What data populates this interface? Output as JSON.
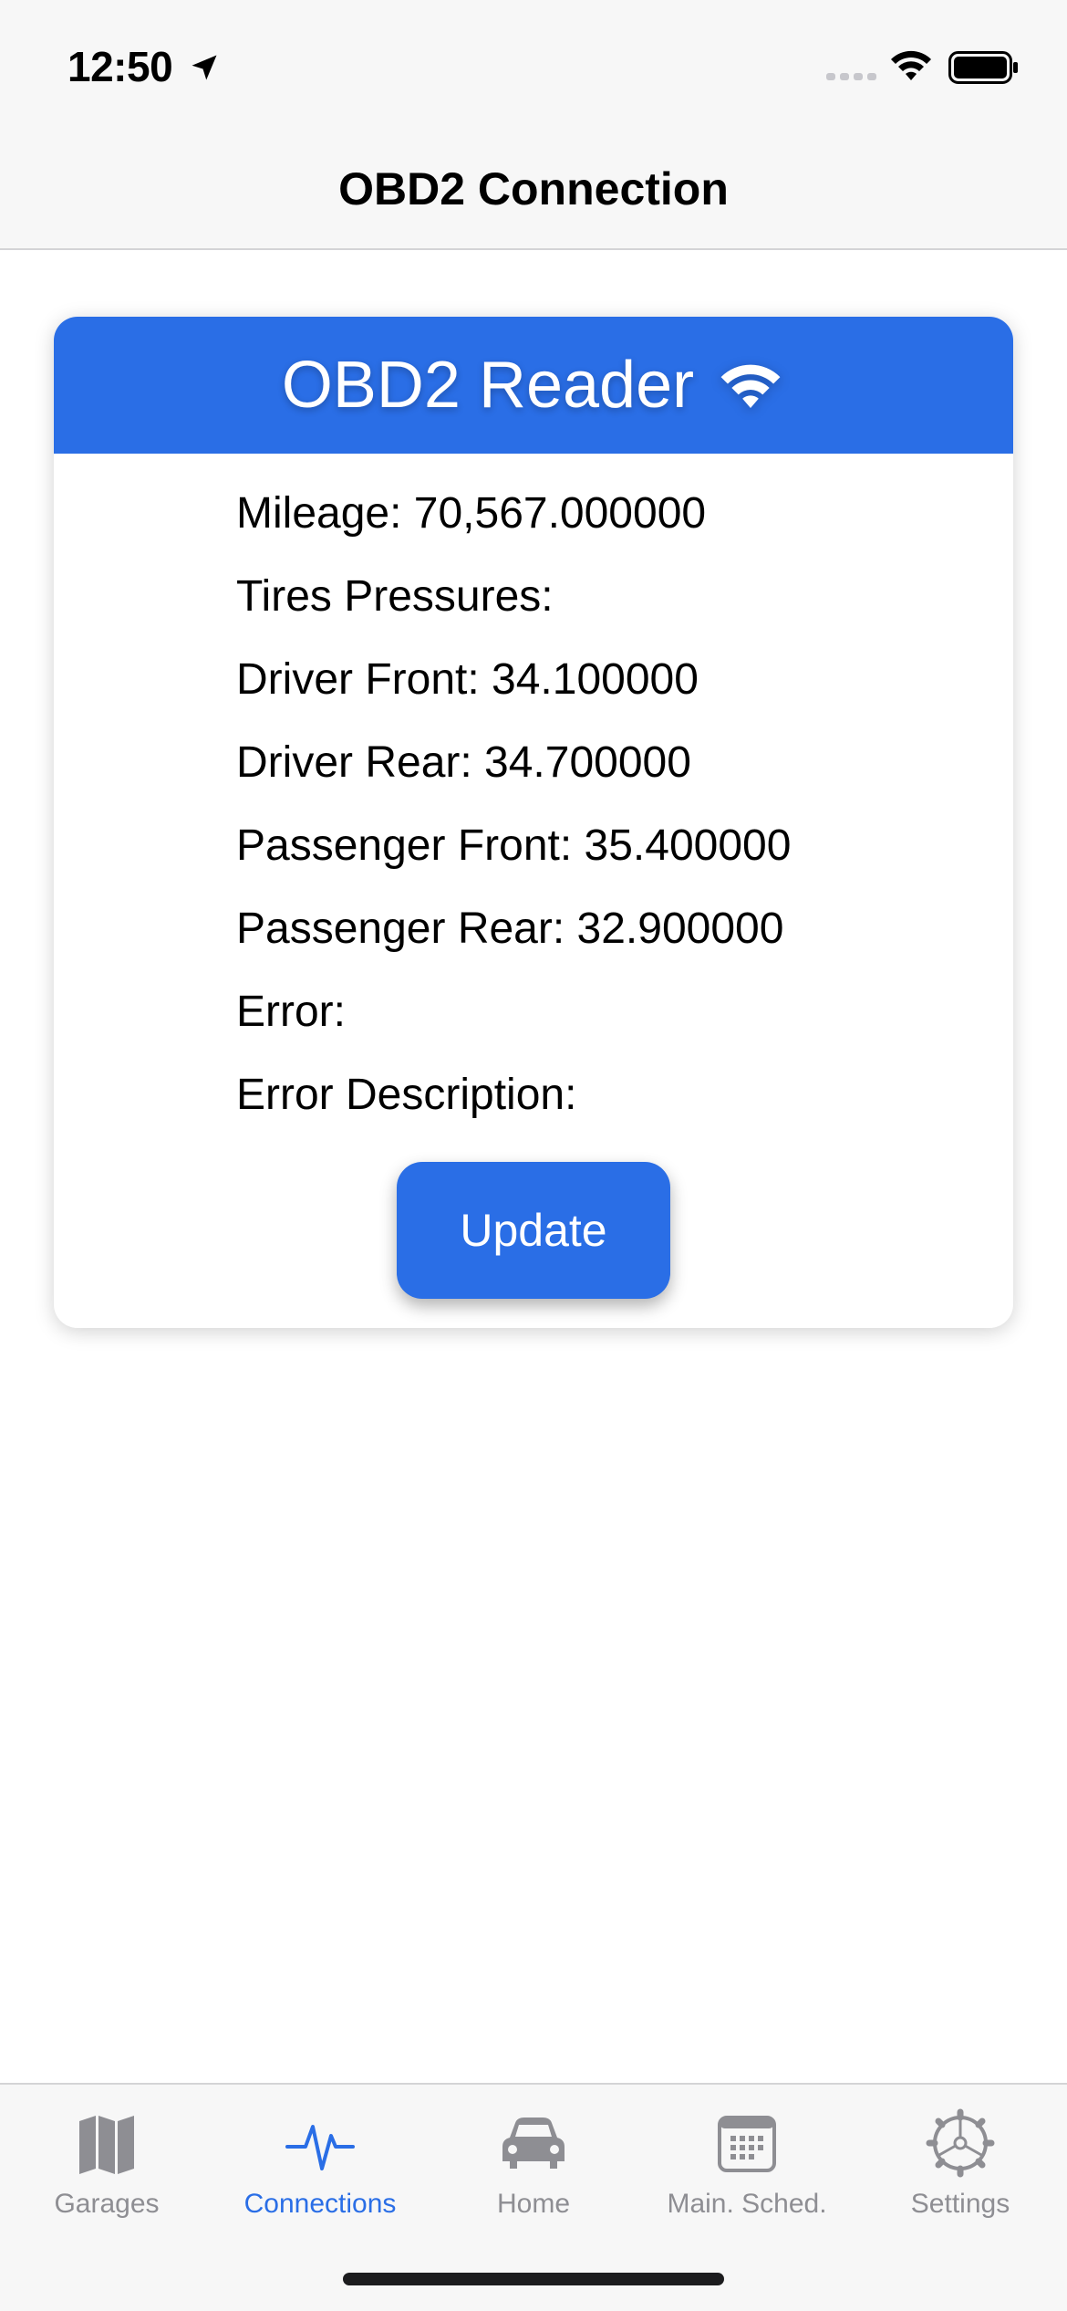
{
  "status_bar": {
    "time": "12:50"
  },
  "nav": {
    "title": "OBD2 Connection"
  },
  "card": {
    "title": "OBD2 Reader",
    "readings": [
      "Mileage: 70,567.000000",
      "Tires Pressures:",
      "Driver Front: 34.100000",
      "Driver Rear: 34.700000",
      "Passenger Front: 35.400000",
      "Passenger Rear: 32.900000",
      "Error:",
      "Error Description:"
    ],
    "update_label": "Update"
  },
  "tabs": [
    {
      "label": "Garages",
      "icon": "map-icon",
      "active": false
    },
    {
      "label": "Connections",
      "icon": "pulse-icon",
      "active": true
    },
    {
      "label": "Home",
      "icon": "car-icon",
      "active": false
    },
    {
      "label": "Main. Sched.",
      "icon": "calendar-icon",
      "active": false
    },
    {
      "label": "Settings",
      "icon": "gear-icon",
      "active": false
    }
  ],
  "colors": {
    "accent": "#2a6ee6",
    "inactive": "#8e8e93",
    "bar_bg": "#f7f7f7"
  }
}
